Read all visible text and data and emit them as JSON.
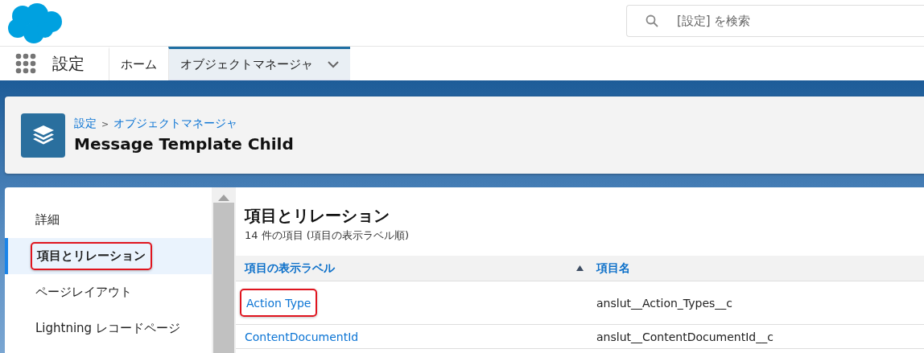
{
  "search": {
    "placeholder": "[設定] を検索"
  },
  "app_name": "設定",
  "tabs": [
    {
      "label": "ホーム",
      "selected": false,
      "has_menu": false
    },
    {
      "label": "オブジェクトマネージャ",
      "selected": true,
      "has_menu": true
    }
  ],
  "header": {
    "breadcrumbs": [
      "設定",
      "オブジェクトマネージャ"
    ],
    "separator": ">",
    "title": "Message Template Child"
  },
  "sidebar": {
    "items": [
      {
        "label": "詳細",
        "selected": false,
        "highlighted": false
      },
      {
        "label": "項目とリレーション",
        "selected": true,
        "highlighted": true
      },
      {
        "label": "ページレイアウト",
        "selected": false,
        "highlighted": false
      },
      {
        "label": "Lightning レコードページ",
        "selected": false,
        "highlighted": false
      }
    ]
  },
  "content": {
    "title": "項目とリレーション",
    "subtitle": "14 件の項目 (項目の表示ラベル順)",
    "table": {
      "columns": [
        {
          "label": "項目の表示ラベル",
          "sorted": true
        },
        {
          "label": "項目名",
          "sorted": false
        }
      ],
      "rows": [
        {
          "label": "Action Type",
          "name": "anslut__Action_Types__c",
          "highlighted": true
        },
        {
          "label": "ContentDocumentId",
          "name": "anslut__ContentDocumentId__c",
          "highlighted": false
        }
      ]
    }
  }
}
